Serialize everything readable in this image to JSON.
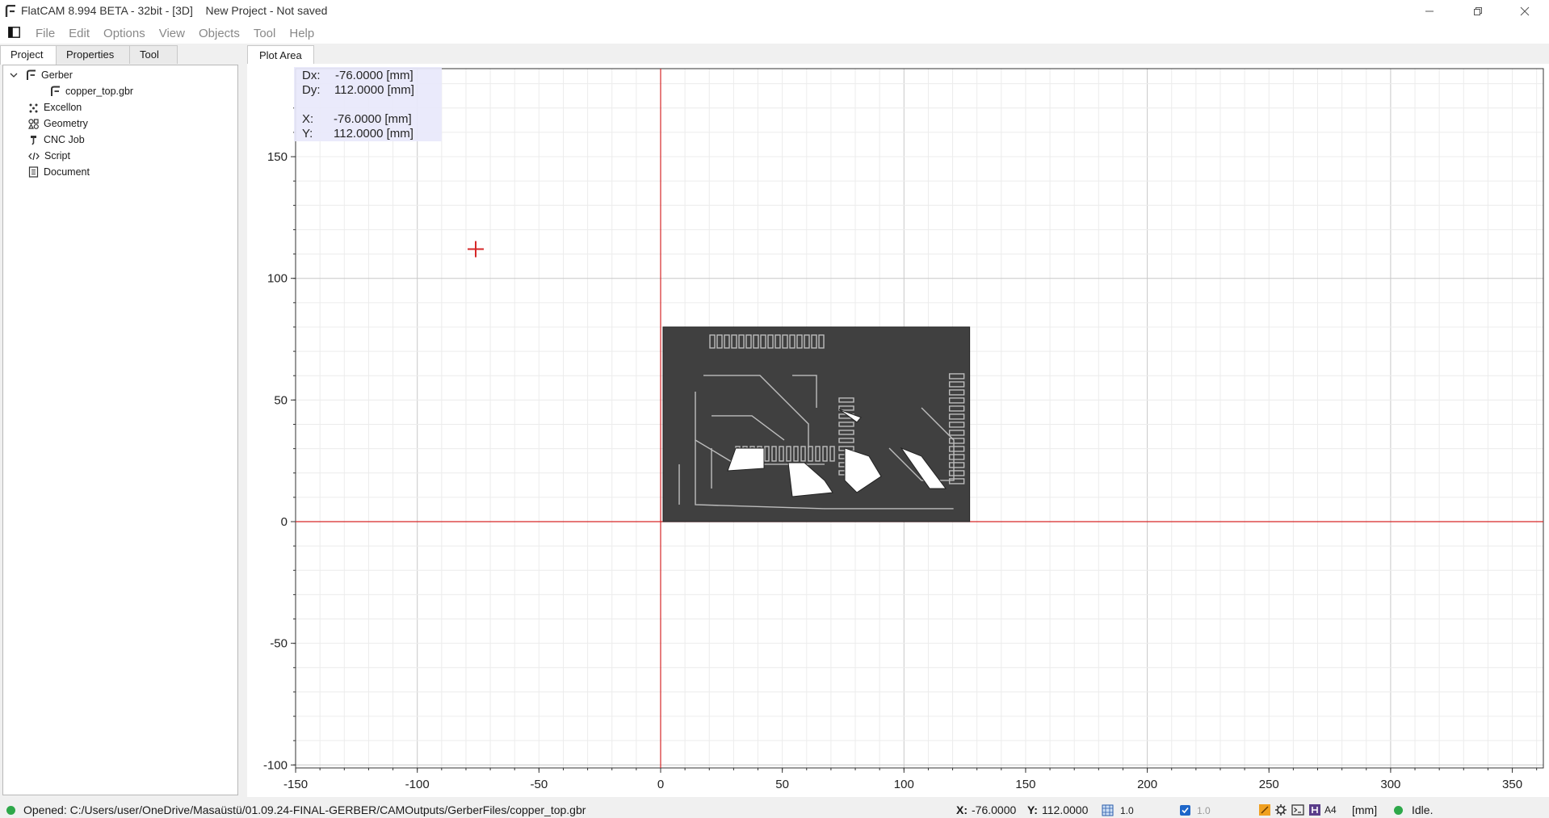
{
  "window": {
    "title": "FlatCAM 8.994 BETA - 32bit - [3D]    New Project - Not saved"
  },
  "menu": [
    "File",
    "Edit",
    "Options",
    "View",
    "Objects",
    "Tool",
    "Help"
  ],
  "left_tabs": [
    "Project",
    "Properties",
    "Tool"
  ],
  "tree": {
    "root": "Gerber",
    "child": "copper_top.gbr",
    "items": [
      "Excellon",
      "Geometry",
      "CNC Job",
      "Script",
      "Document"
    ]
  },
  "plot_tab": "Plot Area",
  "readout": {
    "dx_label": "Dx:",
    "dx_value": "-76.0000 [mm]",
    "dy_label": "Dy:",
    "dy_value": "112.0000 [mm]",
    "x_label": "X:",
    "x_value": "-76.0000 [mm]",
    "y_label": "Y:",
    "y_value": "112.0000 [mm]"
  },
  "axes": {
    "x_ticks": [
      "-150",
      "-100",
      "-50",
      "0",
      "50",
      "100",
      "150",
      "200",
      "250",
      "300",
      "350"
    ],
    "y_ticks": [
      "150",
      "100",
      "50",
      "0",
      "-50",
      "-100"
    ],
    "x_range": [
      -150,
      360
    ],
    "y_range": [
      -100,
      175
    ]
  },
  "status": {
    "message": "Opened: C:/Users/user/OneDrive/Masaüstü/01.09.24-FINAL-GERBER/CAMOutputs/GerberFiles/copper_top.gbr",
    "x_label": "X:",
    "x_value": "-76.0000",
    "y_label": "Y:",
    "y_value": "112.0000",
    "grid_x": "1.0",
    "grid_y": "1.0",
    "paper": "A4",
    "units": "[mm]",
    "state": "Idle."
  },
  "colors": {
    "axis_line": "#d62728",
    "pcb_fill": "#404040",
    "status_ok": "#2ea84a"
  }
}
